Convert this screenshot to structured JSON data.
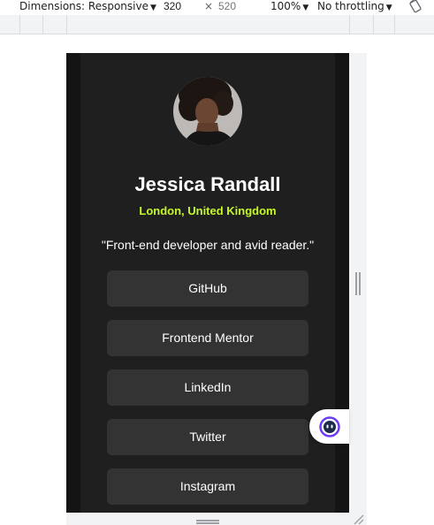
{
  "devtools": {
    "dimensions_label": "Dimensions: Responsive",
    "width_value": "320",
    "times": "×",
    "height_placeholder": "520",
    "zoom_label": "100%",
    "throttle_label": "No throttling",
    "caret": "▼"
  },
  "profile": {
    "name": "Jessica Randall",
    "location": "London, United Kingdom",
    "bio": "\"Front-end developer and avid reader.\"",
    "links": [
      "GitHub",
      "Frontend Mentor",
      "LinkedIn",
      "Twitter",
      "Instagram"
    ]
  },
  "colors": {
    "page_bg": "#141414",
    "card_bg": "#1f1f1f",
    "button_bg": "#333333",
    "accent": "#c4f82a",
    "text": "#ffffff"
  },
  "icons": {
    "rotate": "rotate-icon",
    "assistant": "assistant-bubble-icon"
  }
}
